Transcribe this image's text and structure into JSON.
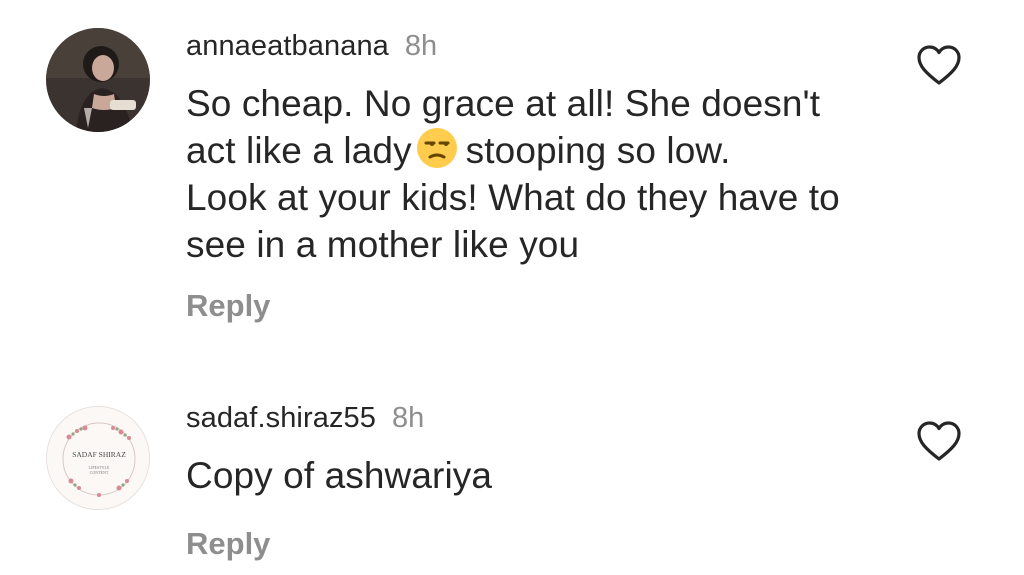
{
  "comments": [
    {
      "username": "annaeatbanana",
      "time": "8h",
      "text_parts": [
        "So cheap. No grace at all! She doesn't",
        "act like a lady",
        "stooping so low.",
        "Look at your kids! What do they have to",
        "see in a mother like you"
      ],
      "emoji_icon": "unamused-face-emoji",
      "reply_label": "Reply",
      "like_icon": "heart-outline-icon"
    },
    {
      "username": "sadaf.shiraz55",
      "time": "8h",
      "text": "Copy of ashwariya",
      "avatar_text": {
        "title": "SADAF SHIRAZ",
        "line1": "LIFESTYLE",
        "line2": "CONTENT"
      },
      "reply_label": "Reply",
      "like_icon": "heart-outline-icon"
    }
  ],
  "colors": {
    "text_primary": "#262626",
    "text_secondary": "#8e8e8e"
  }
}
